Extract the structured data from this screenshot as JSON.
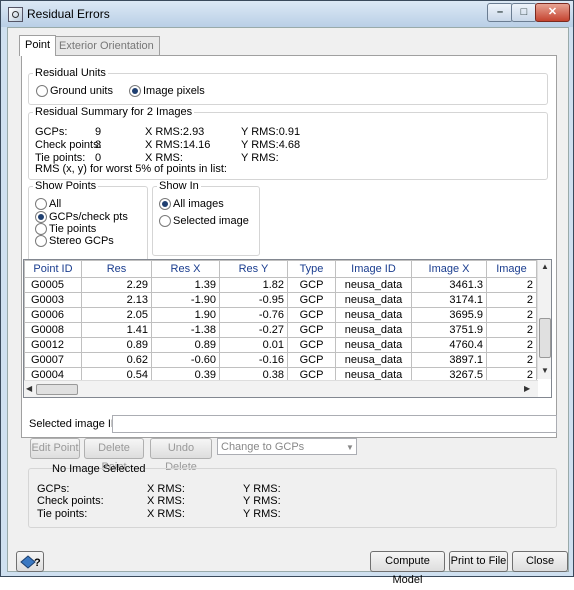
{
  "window": {
    "title": "Residual Errors",
    "min_glyph": "–",
    "max_glyph": "□",
    "close_glyph": "✕"
  },
  "tabs": [
    {
      "label": "Point",
      "active": true
    },
    {
      "label": "Exterior Orientation",
      "active": false
    }
  ],
  "residual_units": {
    "title": "Residual Units",
    "options": [
      "Ground units",
      "Image pixels"
    ],
    "selected": "Image pixels"
  },
  "summary": {
    "title": "Residual Summary for 2 Images",
    "rows": [
      {
        "label": "GCPs:",
        "count": "9",
        "xrms": "X RMS:2.93",
        "yrms": "Y RMS:0.91"
      },
      {
        "label": "Check points:",
        "count": "3",
        "xrms": "X RMS:14.16",
        "yrms": "Y RMS:4.68"
      },
      {
        "label": "Tie points:",
        "count": "0",
        "xrms": "X RMS:",
        "yrms": "Y RMS:"
      }
    ],
    "note": "RMS (x, y) for worst 5% of points in list:"
  },
  "show_points": {
    "title": "Show Points",
    "options": [
      "All",
      "GCPs/check pts",
      "Tie points",
      "Stereo GCPs"
    ],
    "selected": "GCPs/check pts"
  },
  "show_in": {
    "title": "Show In",
    "options": [
      "All images",
      "Selected image"
    ],
    "selected": "All images"
  },
  "table": {
    "columns": [
      "Point ID",
      "Res",
      "Res X",
      "Res Y",
      "Type",
      "Image ID",
      "Image X",
      "Image"
    ],
    "rows": [
      [
        "G0005",
        "2.29",
        "1.39",
        "1.82",
        "GCP",
        "neusa_data",
        "3461.3",
        "2"
      ],
      [
        "G0003",
        "2.13",
        "-1.90",
        "-0.95",
        "GCP",
        "neusa_data",
        "3174.1",
        "2"
      ],
      [
        "G0006",
        "2.05",
        "1.90",
        "-0.76",
        "GCP",
        "neusa_data",
        "3695.9",
        "2"
      ],
      [
        "G0008",
        "1.41",
        "-1.38",
        "-0.27",
        "GCP",
        "neusa_data",
        "3751.9",
        "2"
      ],
      [
        "G0012",
        "0.89",
        "0.89",
        "0.01",
        "GCP",
        "neusa_data",
        "4760.4",
        "2"
      ],
      [
        "G0007",
        "0.62",
        "-0.60",
        "-0.16",
        "GCP",
        "neusa_data",
        "3897.1",
        "2"
      ],
      [
        "G0004",
        "0.54",
        "0.39",
        "0.38",
        "GCP",
        "neusa_data",
        "3267.5",
        "2"
      ]
    ]
  },
  "selected_image": {
    "label": "Selected image ID:",
    "value": ""
  },
  "actions": {
    "edit": "Edit Point",
    "delete": "Delete Point",
    "undo": "Undo Delete",
    "change": "Change to GCPs"
  },
  "image_summary": {
    "title": "No Image Selected",
    "rows": [
      {
        "label": "GCPs:",
        "xrms": "X RMS:",
        "yrms": "Y RMS:"
      },
      {
        "label": "Check points:",
        "xrms": "X RMS:",
        "yrms": "Y RMS:"
      },
      {
        "label": "Tie points:",
        "xrms": "X RMS:",
        "yrms": "Y RMS:"
      }
    ]
  },
  "footer": {
    "help_icon": "help-icon",
    "compute": "Compute Model",
    "print": "Print to File",
    "close": "Close"
  }
}
